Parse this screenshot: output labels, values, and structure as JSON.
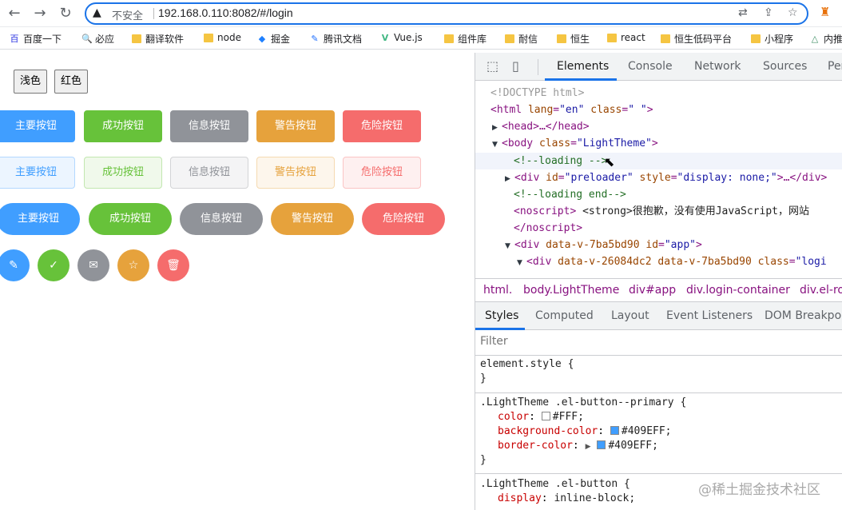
{
  "browser": {
    "nav": {
      "back_icon": "←",
      "forward_icon": "→",
      "reload_icon": "↻"
    },
    "omnibox": {
      "warning_icon": "▲",
      "insecure_label": "不安全",
      "url": "192.168.0.110:8082/#/login",
      "translate_icon": "⇄",
      "share_icon": "⇪",
      "star_icon": "☆"
    },
    "extension_icon": "♜"
  },
  "bookmarks": [
    {
      "icon": "百",
      "label": "百度一下",
      "folder": false
    },
    {
      "icon": "🔍",
      "label": "必应",
      "folder": false
    },
    {
      "icon": "",
      "label": "翻译软件",
      "folder": true
    },
    {
      "icon": "",
      "label": "node",
      "folder": true
    },
    {
      "icon": "◆",
      "label": "掘金",
      "folder": false
    },
    {
      "icon": "✎",
      "label": "腾讯文档",
      "folder": false
    },
    {
      "icon": "V",
      "label": "Vue.js",
      "folder": false
    },
    {
      "icon": "",
      "label": "组件库",
      "folder": true
    },
    {
      "icon": "",
      "label": "耐信",
      "folder": true
    },
    {
      "icon": "",
      "label": "恒生",
      "folder": true
    },
    {
      "icon": "",
      "label": "react",
      "folder": true
    },
    {
      "icon": "",
      "label": "恒生低码平台",
      "folder": true
    },
    {
      "icon": "",
      "label": "小程序",
      "folder": true
    },
    {
      "icon": "△",
      "label": "内推",
      "folder": false
    }
  ],
  "page": {
    "theme_buttons": [
      "浅色",
      "红色"
    ],
    "button_labels": [
      "主要按钮",
      "成功按钮",
      "信息按钮",
      "警告按钮",
      "危险按钮"
    ],
    "colors": {
      "primary": "#409EFF",
      "success": "#67C23A",
      "info": "#909399",
      "warning": "#E6A23C",
      "danger": "#F56C6C",
      "primary_plain_bg": "#ECF5FF",
      "primary_plain_border": "#B3D8FF",
      "success_plain_bg": "#F0F9EB",
      "success_plain_border": "#C2E7B0",
      "info_plain_bg": "#F4F4F5",
      "info_plain_border": "#D3D4D6",
      "warning_plain_bg": "#FDF6EC",
      "warning_plain_border": "#F5DAB1",
      "danger_plain_bg": "#FEF0F0",
      "danger_plain_border": "#FBC4C4"
    },
    "circle_icons": [
      "✎",
      "✓",
      "✉",
      "☆",
      "🗑"
    ]
  },
  "devtools": {
    "tabs": [
      "Elements",
      "Console",
      "Network",
      "Sources",
      "Per"
    ],
    "inspect_icon": "⬚",
    "device_icon": "▯",
    "dom": {
      "doctype": "<!DOCTYPE html>",
      "html_open": "<html",
      "html_attr": "lang",
      "html_val": "\"en\"",
      "html_attr2": "class",
      "html_val2": "\" \"",
      "head": "<head>…</head>",
      "body_open": "<body",
      "body_attr": "class",
      "body_val": "\"LightTheme\"",
      "comment_loading": "<!--loading -->",
      "div_pre": "<div",
      "div_pre_attr": "id",
      "div_pre_val": "\"preloader\"",
      "div_pre_attr2": "style",
      "div_pre_val2": "\"display: none;\"",
      "div_pre_tail": ">…</div>",
      "comment_end": "<!--loading end-->",
      "noscript_open": "<noscript>",
      "noscript_text": "<strong>很抱歉，没有使用JavaScript，网站",
      "noscript_close": "</noscript>",
      "div_app": "<div",
      "div_app_attr": "data-v-7ba5bd90",
      "div_app_attr2": "id",
      "div_app_val": "\"app\"",
      "div_login": "<div",
      "div_login_attr": "data-v-26084dc2",
      "div_login_attr2": "data-v-7ba5bd90",
      "div_login_attr3": "class",
      "div_login_val": "\"logi"
    },
    "breadcrumbs": [
      "html.",
      "body.LightTheme",
      "div#app",
      "div.login-container",
      "div.el-ro"
    ],
    "sub_tabs": [
      "Styles",
      "Computed",
      "Layout",
      "Event Listeners",
      "DOM Breakpoi"
    ],
    "filter_placeholder": "Filter",
    "styles": {
      "element_style": "element.style {",
      "close_brace": "}",
      "rule1_selector": ".LightTheme .el-button--primary {",
      "rule1_props": [
        {
          "name": "color",
          "value": "#FFF;",
          "swatch": "#FFFFFF"
        },
        {
          "name": "background-color",
          "value": "#409EFF;",
          "swatch": "#409EFF"
        },
        {
          "name": "border-color",
          "value": "#409EFF;",
          "swatch": "#409EFF"
        }
      ],
      "rule2_selector": ".LightTheme .el-button {",
      "rule2_prop": {
        "name": "display",
        "value": "inline-block;"
      }
    }
  },
  "watermark": "@稀土掘金技术社区"
}
